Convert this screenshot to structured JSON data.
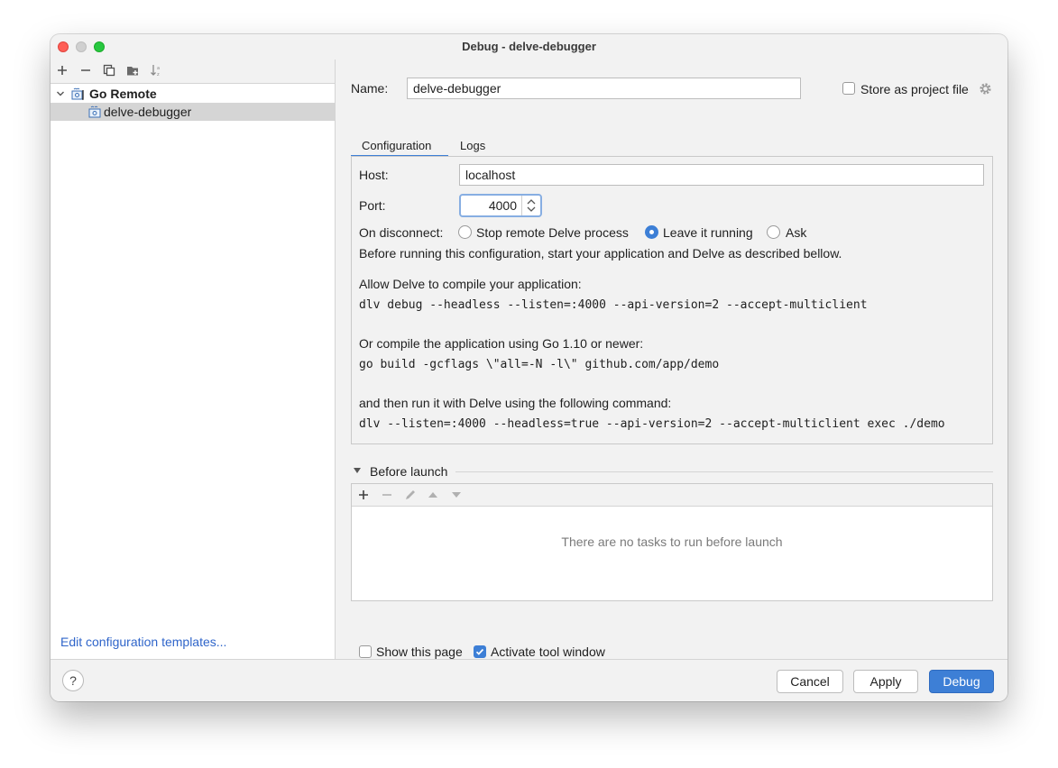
{
  "window": {
    "title": "Debug - delve-debugger"
  },
  "sidebar": {
    "tree": [
      {
        "label": "Go Remote",
        "bold": true,
        "expanded": true
      },
      {
        "label": "delve-debugger",
        "selected": true
      }
    ],
    "footer_link": "Edit configuration templates..."
  },
  "form": {
    "name_label": "Name:",
    "name_value": "delve-debugger",
    "store_label": "Store as project file",
    "store_checked": false
  },
  "tabs": [
    {
      "label": "Configuration",
      "active": true
    },
    {
      "label": "Logs",
      "active": false
    }
  ],
  "config": {
    "host_label": "Host:",
    "host_value": "localhost",
    "port_label": "Port:",
    "port_value": "4000",
    "disconnect_label": "On disconnect:",
    "disconnect_options": [
      {
        "label": "Stop remote Delve process",
        "checked": false
      },
      {
        "label": "Leave it running",
        "checked": true
      },
      {
        "label": "Ask",
        "checked": false
      }
    ],
    "intro": "Before running this configuration, start your application and Delve as described bellow.",
    "step1_label": "Allow Delve to compile your application:",
    "step1_cmd": "dlv debug --headless --listen=:4000 --api-version=2 --accept-multiclient",
    "step2_label": "Or compile the application using Go 1.10 or newer:",
    "step2_cmd": "go build -gcflags \\\"all=-N -l\\\" github.com/app/demo",
    "step3_label": "and then run it with Delve using the following command:",
    "step3_cmd": "dlv --listen=:4000 --headless=true --api-version=2 --accept-multiclient exec ./demo"
  },
  "before_launch": {
    "title": "Before launch",
    "empty_text": "There are no tasks to run before launch"
  },
  "options": {
    "show_page_label": "Show this page",
    "show_page_checked": false,
    "activate_label": "Activate tool window",
    "activate_checked": true
  },
  "buttons": {
    "help": "?",
    "cancel": "Cancel",
    "apply": "Apply",
    "debug": "Debug"
  },
  "colors": {
    "accent": "#3d7fd6",
    "link": "#2f65ca",
    "selection": "#d5d5d5"
  }
}
